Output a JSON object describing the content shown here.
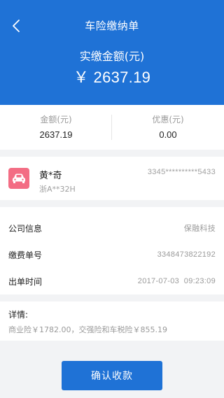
{
  "header": {
    "title": "车险缴纳单",
    "amount_label": "实缴金额(元)",
    "amount_value": "￥ 2637.19",
    "color": "#1f72d6"
  },
  "summary": {
    "amount_label": "金额(元)",
    "amount_value": "2637.19",
    "discount_label": "优惠(元)",
    "discount_value": "0.00"
  },
  "vehicle": {
    "owner": "黄*奇",
    "plate": "浙A**32H",
    "policy_no": "3345**********5433",
    "icon": "car-icon",
    "icon_color": "#f36d84"
  },
  "info": {
    "rows": [
      {
        "label": "公司信息",
        "value": "保融科技"
      },
      {
        "label": "缴费单号",
        "value": "3348473822192"
      },
      {
        "label": "出单时间",
        "value": "2017-07-03  09:23:09"
      }
    ]
  },
  "detail": {
    "label": "详情:",
    "text": "商业险￥1782.00，交强险和车税险￥855.19"
  },
  "action": {
    "confirm_label": "确认收款"
  }
}
